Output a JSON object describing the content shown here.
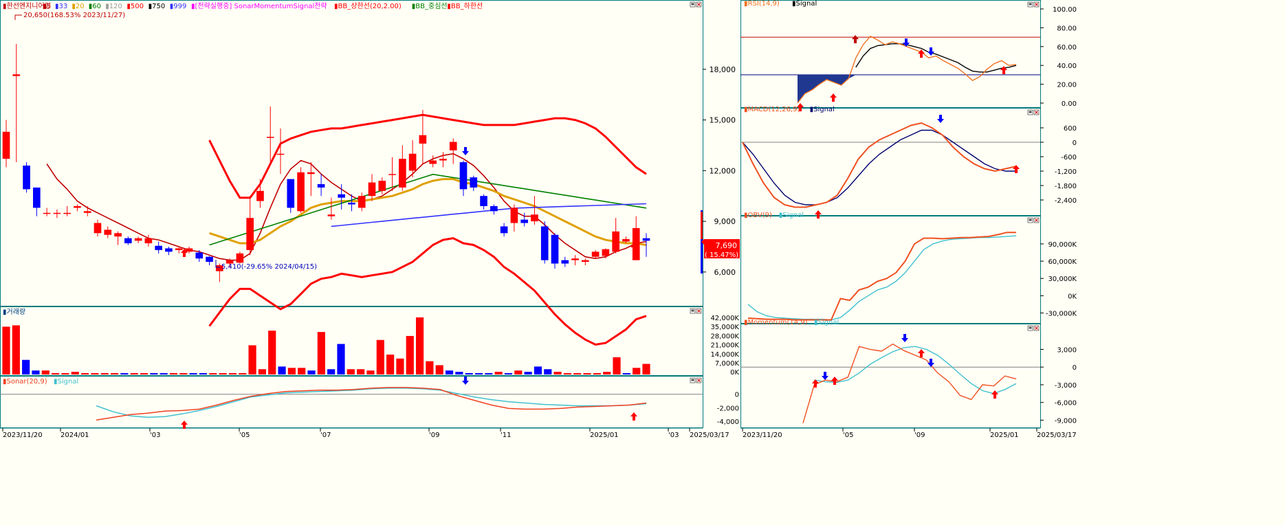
{
  "colors": {
    "up": "#ff0000",
    "down": "#0000ff",
    "bg": "#fffff5",
    "frame": "#007a7a",
    "ma5": "#c00000",
    "ma20": "#e0a000",
    "ma60": "#008000",
    "ma120": "#3030ff",
    "bb": "#ff0000",
    "signal": "#40c0d0"
  },
  "main": {
    "legend": [
      {
        "text": "▮한선엔지니어링",
        "color": "#c00000"
      },
      {
        "text": "▮5",
        "color": "#c00000"
      },
      {
        "text": "▮33",
        "color": "#3030ff"
      },
      {
        "text": "▮20",
        "color": "#e0a000"
      },
      {
        "text": "▮60",
        "color": "#008000"
      },
      {
        "text": "▮120",
        "color": "#999999"
      },
      {
        "text": "▮500",
        "color": "#ff0000"
      },
      {
        "text": "▮750",
        "color": "#000000"
      },
      {
        "text": "▮999",
        "color": "#3030ff"
      },
      {
        "text": "▮[전략실행중] SonarMomentumSignal전략",
        "color": "#ff00ff"
      },
      {
        "text": "▮BB_상한선(20,2.00)",
        "color": "#ff0000"
      },
      {
        "text": "▮BB_중심선",
        "color": "#008000"
      },
      {
        "text": "▮BB_하한선",
        "color": "#ff0000"
      }
    ],
    "high_label": "20,650(168.53% 2023/11/27)",
    "low_label": "5,410(-29.65% 2024/04/15)",
    "price_ticks": [
      "18,000",
      "15,000",
      "12,000",
      "9,000",
      "6,000"
    ],
    "current_price": "7,690",
    "current_change": "( 15.47%)"
  },
  "volume": {
    "title": "▮거래량",
    "ticks": [
      "42,000K",
      "35,000K",
      "28,000K",
      "21,000K",
      "14,000K",
      "7,000K",
      "0K"
    ]
  },
  "sonar": {
    "title": "▮Sonar(20,9)",
    "signal": "▮Signal",
    "ticks": [
      "0",
      "-2,000",
      "-4,000"
    ]
  },
  "x_axis_left": [
    "2023/11/20",
    "2024/01",
    "'03",
    "'05",
    "'07",
    "'09",
    "'11",
    "2025/01",
    "'03",
    "2025/03/17"
  ],
  "rsi": {
    "title": "▮RSI(14,9)",
    "signal": "▮Signal",
    "ticks": [
      "100.00",
      "80.00",
      "60.00",
      "40.00",
      "20.00",
      "0.00"
    ]
  },
  "macd": {
    "title": "▮MACD(12,26,9)",
    "signal": "▮Signal",
    "ticks": [
      "600",
      "0",
      "-600",
      "-1,200",
      "-1,800",
      "-2,400"
    ]
  },
  "obv": {
    "title": "▮OBV(9)",
    "signal": "▮Signal",
    "ticks": [
      "90,000K",
      "60,000K",
      "30,000K",
      "0K",
      "-30,000K"
    ]
  },
  "momentum": {
    "title": "▮Momentum(14,9)",
    "signal": "▮Signal",
    "ticks": [
      "3,000",
      "0",
      "-3,000",
      "-6,000",
      "-9,000"
    ]
  },
  "x_axis_right": [
    "2023/11/20",
    "'05",
    "'09",
    "2025/01",
    "2025/03/17"
  ],
  "chart_data": [
    {
      "type": "candlestick",
      "title": "한선엔지니어링",
      "x": [
        "2023/11/20",
        "2023/11/27",
        "2023/12/04",
        "2023/12/11",
        "2023/12/18",
        "2023/12/26",
        "2024/01/02",
        "2024/01/08",
        "2024/01/15",
        "2024/01/22",
        "2024/01/29",
        "2024/02/05",
        "2024/02/13",
        "2024/02/19",
        "2024/02/26",
        "2024/03/04",
        "2024/03/11",
        "2024/03/18",
        "2024/03/25",
        "2024/04/01",
        "2024/04/08",
        "2024/04/15",
        "2024/04/22",
        "2024/04/29",
        "2024/05/06",
        "2024/05/13",
        "2024/05/20",
        "2024/05/27",
        "2024/06/03",
        "2024/06/10",
        "2024/06/17",
        "2024/06/24",
        "2024/07/01",
        "2024/07/08",
        "2024/07/15",
        "2024/07/22",
        "2024/07/29",
        "2024/08/05",
        "2024/08/12",
        "2024/08/19",
        "2024/08/26",
        "2024/09/02",
        "2024/09/09",
        "2024/09/16",
        "2024/09/23",
        "2024/09/30",
        "2024/10/07",
        "2024/10/14",
        "2024/10/21",
        "2024/10/28",
        "2024/11/04",
        "2024/11/11",
        "2024/11/18",
        "2024/11/25",
        "2024/12/02",
        "2024/12/09",
        "2024/12/16",
        "2024/12/23",
        "2024/12/30",
        "2025/01/06",
        "2025/01/13",
        "2025/01/20",
        "2025/02/03",
        "2025/02/10"
      ],
      "open": [
        12700,
        17600,
        12300,
        11000,
        9500,
        9500,
        9500,
        9800,
        9500,
        8300,
        8200,
        8100,
        8000,
        7850,
        7700,
        7550,
        7400,
        7300,
        7200,
        7150,
        6900,
        6050,
        6500,
        6550,
        7300,
        10200,
        14000,
        13000,
        11500,
        9600,
        11800,
        11200,
        9300,
        10600,
        10100,
        9800,
        10500,
        10800,
        11800,
        11000,
        12000,
        13600,
        12400,
        12600,
        13200,
        12500,
        11600,
        10500,
        9900,
        8700,
        8900,
        9100,
        9000,
        8700,
        8200,
        6700,
        6700,
        6600,
        6900,
        6950,
        7200,
        7800,
        6700,
        8000
      ],
      "close": [
        14300,
        17700,
        10900,
        9800,
        9500,
        9500,
        9500,
        9900,
        9600,
        8900,
        8500,
        8300,
        7700,
        8000,
        8000,
        7300,
        7200,
        7400,
        7400,
        6800,
        6600,
        6400,
        6700,
        7100,
        9200,
        10800,
        14000,
        13000,
        9800,
        11900,
        11900,
        11000,
        9400,
        10400,
        10000,
        10500,
        11300,
        11400,
        11800,
        12700,
        13000,
        14100,
        12600,
        12700,
        13700,
        10900,
        11000,
        9900,
        9600,
        8300,
        9800,
        8900,
        9400,
        6700,
        6500,
        6500,
        6800,
        6700,
        7200,
        7350,
        8400,
        7950,
        8600,
        7850
      ],
      "high": [
        15000,
        19500,
        12500,
        11000,
        9800,
        9700,
        9900,
        10000,
        9900,
        9100,
        8700,
        8400,
        8100,
        8100,
        8200,
        7800,
        7500,
        7500,
        7500,
        7300,
        6950,
        6500,
        6800,
        7200,
        10500,
        11500,
        15800,
        14500,
        11500,
        12200,
        12500,
        11800,
        10400,
        11200,
        10600,
        10700,
        11800,
        11600,
        12800,
        13500,
        13800,
        15600,
        12900,
        13100,
        13900,
        12600,
        11700,
        10600,
        10000,
        8900,
        10000,
        9500,
        10500,
        9000,
        8300,
        6900,
        7000,
        6800,
        7300,
        7400,
        9200,
        8100,
        9300,
        8300
      ],
      "low": [
        12200,
        12500,
        10700,
        9300,
        9300,
        9200,
        9300,
        9600,
        9300,
        8100,
        8000,
        7600,
        7600,
        7700,
        7500,
        7100,
        7000,
        7100,
        7100,
        6600,
        6400,
        5410,
        6300,
        6500,
        7000,
        9800,
        12500,
        11800,
        9500,
        9500,
        10500,
        10500,
        9100,
        9700,
        9600,
        9600,
        10200,
        10600,
        10800,
        10800,
        11600,
        12400,
        12200,
        12200,
        12400,
        10500,
        10800,
        9700,
        9400,
        8100,
        8400,
        8700,
        8800,
        6500,
        6200,
        6300,
        6400,
        6400,
        6800,
        6800,
        7100,
        7700,
        6700,
        6900
      ],
      "series_lines": [
        {
          "name": "5",
          "values": [
            null,
            null,
            null,
            null,
            12400,
            11500,
            10900,
            10200,
            9800,
            9500,
            9200,
            8900,
            8600,
            8300,
            8000,
            7900,
            7700,
            7500,
            7300,
            7200,
            7000,
            6800,
            6700,
            6700,
            7100,
            8300,
            9800,
            11200,
            12100,
            12600,
            12400,
            11800,
            11300,
            10900,
            10500,
            10200,
            10300,
            10500,
            10900,
            11300,
            11800,
            12400,
            12700,
            12900,
            13000,
            12700,
            12300,
            11700,
            11000,
            10200,
            9600,
            9300,
            9300,
            8800,
            8200,
            7700,
            7300,
            6900,
            6800,
            6900,
            7200,
            7400,
            7700,
            7800
          ]
        },
        {
          "name": "20",
          "values": [
            null,
            null,
            null,
            null,
            null,
            null,
            null,
            null,
            null,
            null,
            null,
            null,
            null,
            null,
            null,
            null,
            null,
            null,
            null,
            null,
            8300,
            8100,
            7900,
            7700,
            7700,
            7900,
            8300,
            8700,
            9000,
            9400,
            9800,
            10000,
            10100,
            10200,
            10200,
            10200,
            10300,
            10400,
            10500,
            10700,
            10900,
            11200,
            11400,
            11500,
            11500,
            11300,
            11200,
            11000,
            10800,
            10500,
            10300,
            10100,
            9900,
            9600,
            9300,
            9000,
            8700,
            8400,
            8100,
            7900,
            7800,
            7700,
            7700,
            7600
          ]
        },
        {
          "name": "BB_상한선",
          "values": [
            null,
            null,
            null,
            null,
            null,
            null,
            null,
            null,
            null,
            null,
            null,
            null,
            null,
            null,
            null,
            null,
            null,
            null,
            null,
            null,
            13800,
            12600,
            11400,
            10400,
            10400,
            11200,
            12400,
            13600,
            13900,
            14100,
            14300,
            14400,
            14500,
            14500,
            14600,
            14700,
            14800,
            14900,
            15000,
            15100,
            15200,
            15300,
            15200,
            15100,
            15000,
            14900,
            14800,
            14700,
            14700,
            14700,
            14700,
            14800,
            14900,
            15000,
            15100,
            15100,
            15000,
            14800,
            14500,
            14000,
            13400,
            12800,
            12200,
            11800
          ]
        }
      ],
      "ylim": [
        4000,
        20650
      ]
    },
    {
      "type": "bar",
      "title": "거래량",
      "unit": "K",
      "values": [
        36000,
        37000,
        11000,
        3000,
        3000,
        1000,
        1000,
        2000,
        1000,
        1000,
        1000,
        1000,
        1000,
        1000,
        1000,
        1000,
        1000,
        1000,
        1000,
        1000,
        1000,
        1000,
        1000,
        1000,
        1000,
        22000,
        4000,
        33000,
        6000,
        5000,
        5000,
        3000,
        32000,
        4000,
        23000,
        4000,
        4000,
        3000,
        26000,
        15000,
        12000,
        29000,
        43000,
        10000,
        7000,
        3000,
        2000,
        1000,
        1000,
        1000,
        2000,
        1000,
        3000,
        2000,
        6000,
        4000,
        2000,
        1000,
        1000,
        1000,
        1000,
        2000,
        13000,
        1000,
        5000,
        8000
      ],
      "ylim": [
        0,
        45000
      ]
    },
    {
      "type": "line",
      "title": "Sonar(20,9)",
      "series": [
        {
          "name": "Sonar",
          "values": [
            -3800,
            -3400,
            -3000,
            -2800,
            -2500,
            -2400,
            -2200,
            -1600,
            -900,
            -300,
            100,
            400,
            500,
            600,
            600,
            700,
            900,
            1000,
            1000,
            900,
            700,
            -200,
            -900,
            -1600,
            -2100,
            -2200,
            -2200,
            -2100,
            -1900,
            -1800,
            -1700,
            -1600,
            -1300
          ]
        },
        {
          "name": "Signal",
          "values": [
            -1700,
            -2600,
            -3200,
            -3400,
            -3300,
            -2900,
            -2400,
            -1800,
            -1100,
            -400,
            -100,
            200,
            300,
            400,
            500,
            600,
            800,
            900,
            900,
            800,
            600,
            100,
            -400,
            -800,
            -1100,
            -1300,
            -1500,
            -1600,
            -1700,
            -1700,
            -1700,
            -1600,
            -1400
          ]
        }
      ],
      "ylim": [
        -4800,
        1800
      ]
    },
    {
      "type": "line",
      "title": "RSI(14,9)",
      "series": [
        {
          "name": "RSI",
          "values": [
            0,
            10,
            14,
            20,
            25,
            22,
            19,
            26,
            48,
            62,
            71,
            67,
            62,
            65,
            63,
            60,
            57,
            54,
            48,
            50,
            45,
            41,
            37,
            31,
            24,
            28,
            36,
            42,
            45,
            40,
            41
          ]
        },
        {
          "name": "Signal",
          "values": [
            null,
            null,
            null,
            null,
            null,
            null,
            null,
            null,
            38,
            50,
            58,
            61,
            62,
            63,
            63,
            62,
            60,
            58,
            54,
            52,
            49,
            46,
            43,
            38,
            34,
            33,
            33,
            35,
            37,
            38,
            40
          ]
        }
      ],
      "ylim": [
        0,
        100
      ]
    },
    {
      "type": "line",
      "title": "MACD(12,26,9)",
      "series": [
        {
          "name": "MACD",
          "values": [
            0,
            -900,
            -1700,
            -2300,
            -2600,
            -2700,
            -2700,
            -2600,
            -2500,
            -2200,
            -1500,
            -700,
            -200,
            100,
            300,
            500,
            700,
            800,
            600,
            300,
            -200,
            -600,
            -900,
            -1100,
            -1200,
            -1100,
            -1000
          ]
        },
        {
          "name": "Signal",
          "values": [
            0,
            -500,
            -1100,
            -1700,
            -2200,
            -2500,
            -2600,
            -2600,
            -2500,
            -2300,
            -1900,
            -1400,
            -900,
            -500,
            -200,
            100,
            300,
            500,
            500,
            300,
            0,
            -300,
            -600,
            -900,
            -1100,
            -1200,
            -1200
          ]
        }
      ],
      "ylim": [
        -3000,
        1000
      ]
    },
    {
      "type": "line",
      "title": "OBV(9)",
      "unit": "K",
      "series": [
        {
          "name": "OBV",
          "values": [
            -39000,
            -40000,
            -41000,
            -41000,
            -41000,
            -42000,
            -42000,
            -42000,
            -42000,
            -42000,
            -5000,
            -8000,
            10000,
            15000,
            25000,
            30000,
            40000,
            60000,
            90000,
            100000,
            100000,
            99000,
            100000,
            101000,
            101000,
            102000,
            103000,
            106000,
            110000,
            110000
          ]
        },
        {
          "name": "Signal",
          "values": [
            -15000,
            -28000,
            -35000,
            -38000,
            -39000,
            -40000,
            -41000,
            -41000,
            -41000,
            -42000,
            -38000,
            -25000,
            -10000,
            0,
            10000,
            15000,
            25000,
            40000,
            60000,
            80000,
            90000,
            95000,
            98000,
            99000,
            100000,
            101000,
            101000,
            102000,
            103000,
            104000
          ]
        }
      ],
      "ylim": [
        -45000,
        115000
      ]
    },
    {
      "type": "line",
      "title": "Momentum(14,9)",
      "series": [
        {
          "name": "Momentum",
          "values": [
            -9500,
            -3000,
            -2200,
            -2500,
            -1700,
            3500,
            3000,
            2700,
            3900,
            2800,
            2000,
            1200,
            -1000,
            -2500,
            -4800,
            -5500,
            -3000,
            -3200,
            -1500,
            -2000
          ]
        },
        {
          "name": "Signal",
          "values": [
            null,
            -2200,
            -2500,
            -2600,
            -2200,
            -1000,
            500,
            1600,
            2600,
            3300,
            3500,
            3000,
            2000,
            500,
            -1200,
            -2800,
            -4000,
            -4500,
            -3800,
            -2800
          ]
        }
      ],
      "ylim": [
        -10000,
        5500
      ]
    }
  ]
}
